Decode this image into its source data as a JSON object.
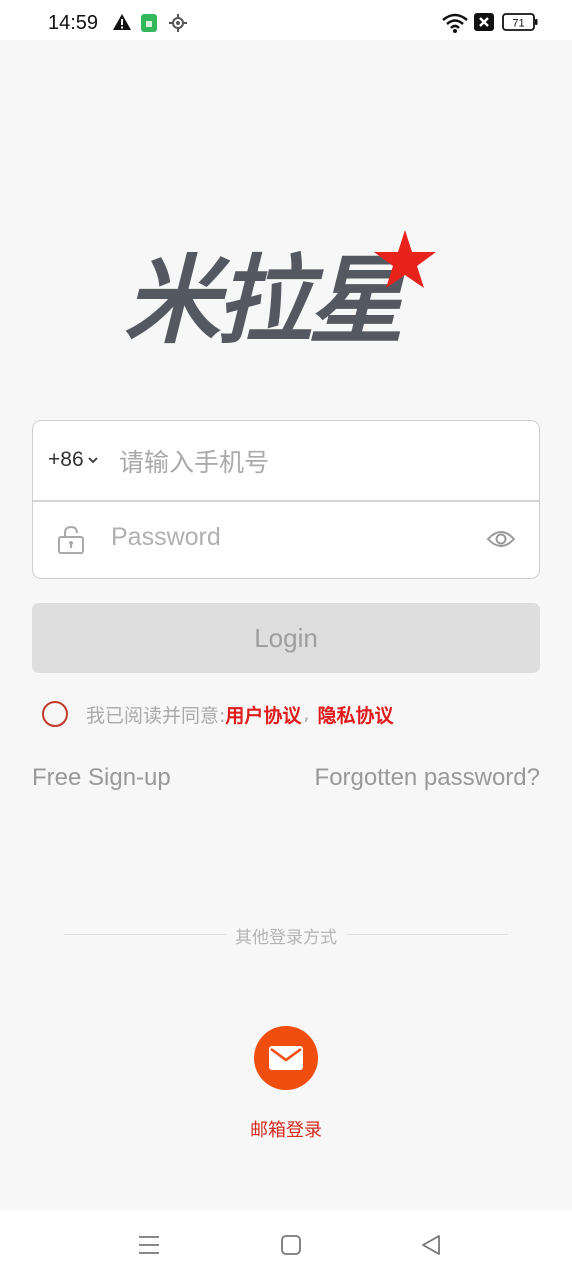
{
  "status_bar": {
    "time": "14:59",
    "battery": "71",
    "icons": [
      "warning-icon",
      "sim-icon",
      "location-icon",
      "wifi-icon",
      "no-signal-icon",
      "battery-icon"
    ]
  },
  "logo": {
    "text": "米拉星",
    "accent_color": "#e8231c",
    "text_color": "#545860"
  },
  "login_form": {
    "country_code": "+86",
    "phone_placeholder": "请输入手机号",
    "password_placeholder": "Password"
  },
  "login_button": {
    "label": "Login"
  },
  "agreement": {
    "prefix": "我已阅读并同意:",
    "user_agreement": "用户协议",
    "separator": ",",
    "privacy_policy": "隐私协议"
  },
  "links": {
    "signup": "Free Sign-up",
    "forgot": "Forgotten password?"
  },
  "other_login": {
    "title": "其他登录方式",
    "email_label": "邮箱登录"
  },
  "nav_bar": {
    "icons": [
      "menu-icon",
      "home-icon",
      "back-icon"
    ]
  },
  "colors": {
    "accent": "#f04e0e",
    "link_red": "#e01b1b",
    "background": "#f7f7f7"
  }
}
